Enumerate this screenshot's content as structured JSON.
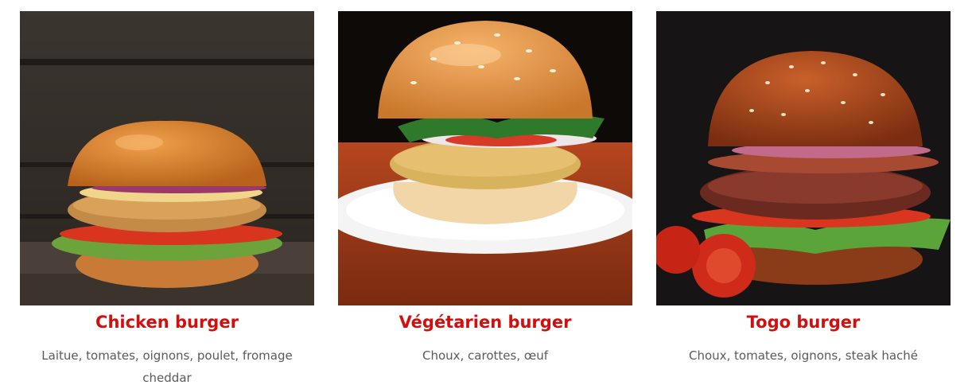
{
  "menu": {
    "items": [
      {
        "name": "Chicken burger",
        "description": "Laitue, tomates, oignons, poulet, fromage cheddar",
        "image_icon": "chicken-burger-photo"
      },
      {
        "name": "Végétarien burger",
        "description": "Choux, carottes, œuf",
        "image_icon": "veggie-burger-photo"
      },
      {
        "name": "Togo burger",
        "description": "Choux, tomates, oignons, steak haché",
        "image_icon": "togo-burger-photo"
      }
    ]
  },
  "colors": {
    "title_red": "#d10f0f",
    "button_red": "#e8231f",
    "text_gray": "#5a5a5a"
  }
}
